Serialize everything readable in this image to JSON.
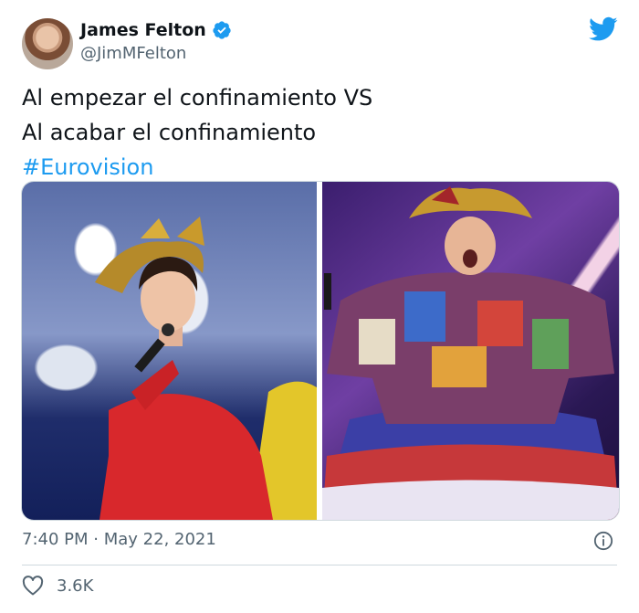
{
  "author": {
    "name": "James Felton",
    "handle": "@JimMFelton",
    "verified": true
  },
  "tweet": {
    "lines": [
      "Al empezar el confinamiento VS",
      "Al acabar el confinamiento"
    ],
    "hashtag": "#Eurovision"
  },
  "meta": {
    "time": "7:40 PM",
    "date": "May 22, 2021",
    "separator": "·"
  },
  "actions": {
    "likes": "3.6K"
  },
  "icons": [
    "verified-badge-icon",
    "twitter-bird-icon",
    "info-icon",
    "heart-icon"
  ],
  "colors": {
    "link": "#1d9bf0",
    "muted": "#536471",
    "text": "#0f1419"
  }
}
